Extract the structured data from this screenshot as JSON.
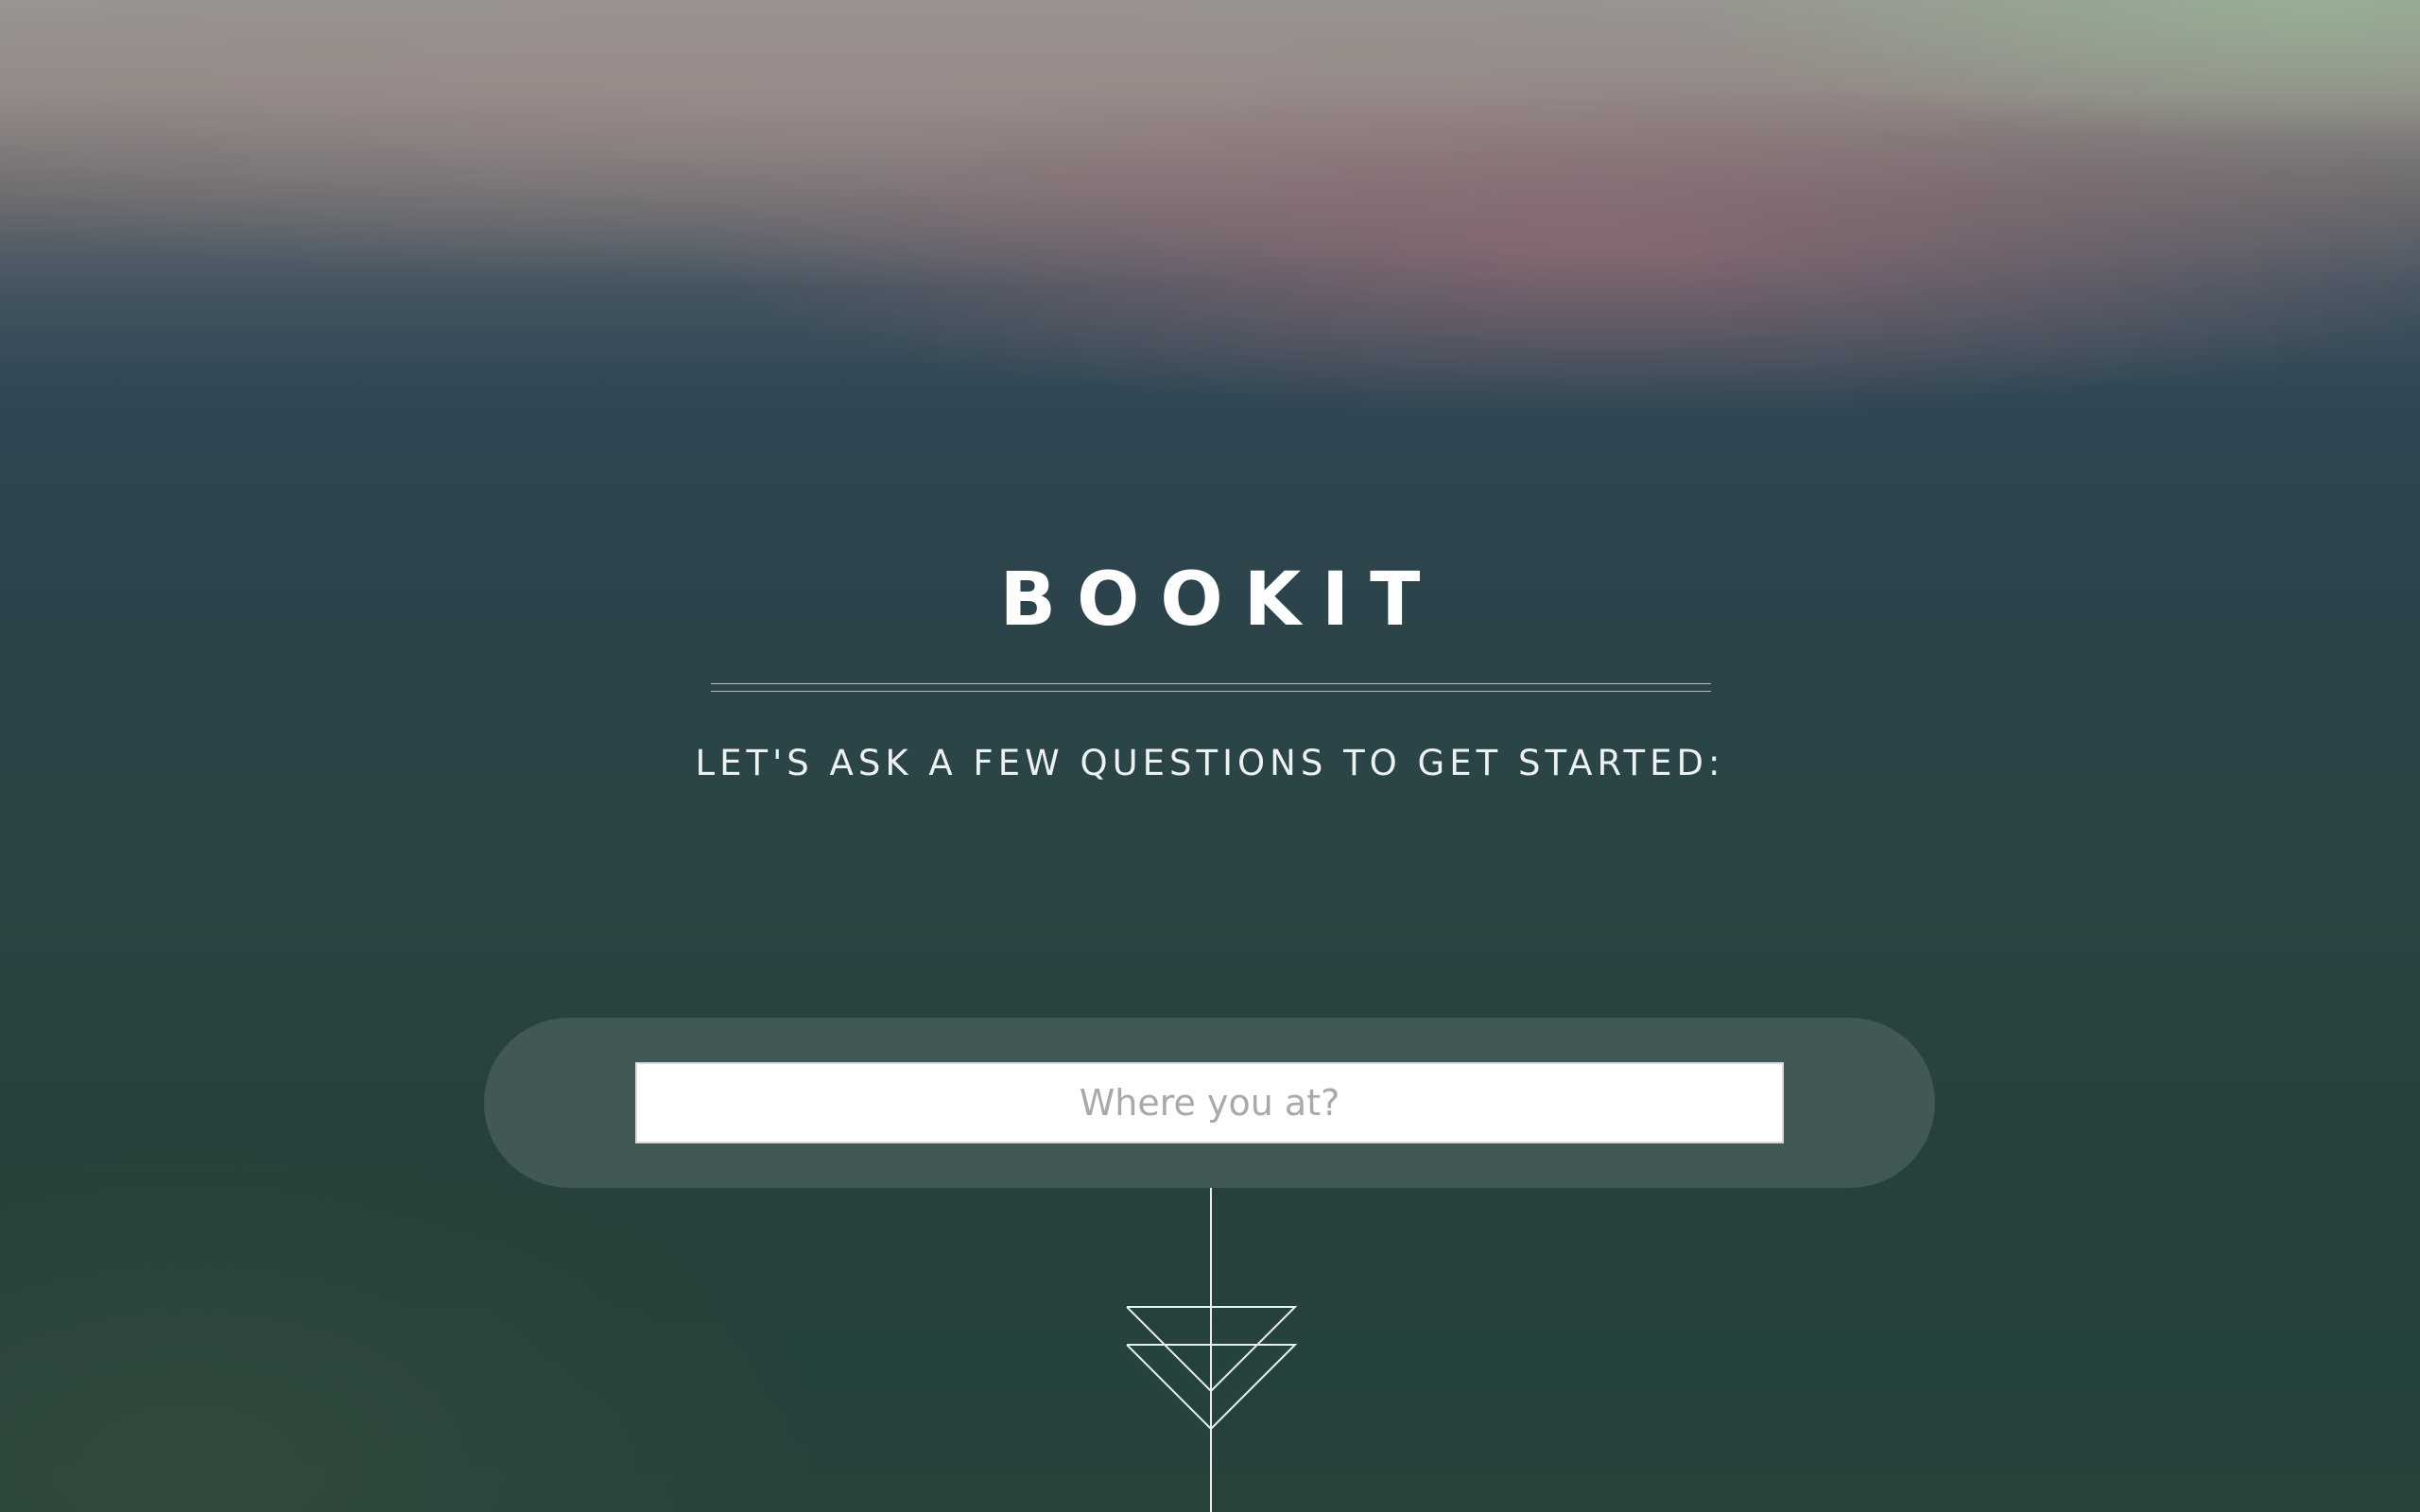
{
  "app": {
    "title": "BOOKIT",
    "subtitle": "LET'S ASK A FEW QUESTIONS TO GET STARTED:"
  },
  "search": {
    "value": "",
    "placeholder": "Where you at?"
  },
  "icons": {
    "connector": "double-chevron-down-icon"
  }
}
